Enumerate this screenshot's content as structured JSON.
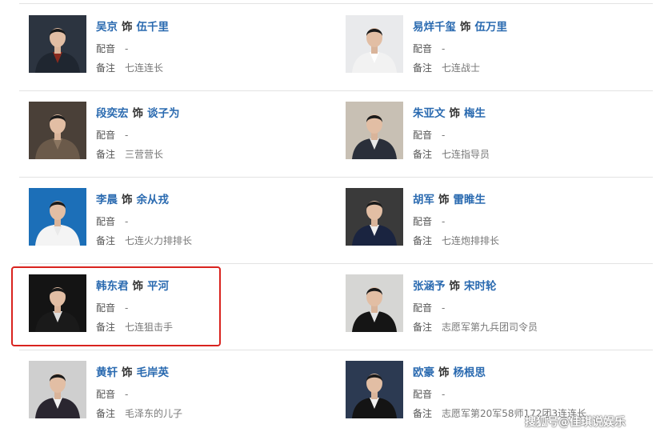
{
  "cast": {
    "role_word": "饰",
    "dub_label": "配音",
    "note_label": "备注",
    "rows": [
      {
        "left": {
          "actor": "吴京",
          "character": "伍千里",
          "dub": "-",
          "note": "七连连长",
          "bg": "#2c3440",
          "suit": "#1f2630",
          "shirt": "#8a2a1e"
        },
        "right": {
          "actor": "易烊千玺",
          "character": "伍万里",
          "dub": "-",
          "note": "七连战士",
          "bg": "#e9eaec",
          "suit": "#f2f2f2",
          "shirt": "#ffffff"
        }
      },
      {
        "left": {
          "actor": "段奕宏",
          "character": "谈子为",
          "dub": "-",
          "note": "三营营长",
          "bg": "#4a4038",
          "suit": "#6b5a4a",
          "shirt": "#8a7560"
        },
        "right": {
          "actor": "朱亚文",
          "character": "梅生",
          "dub": "-",
          "note": "七连指导员",
          "bg": "#c8c0b4",
          "suit": "#2a2f3a",
          "shirt": "#e8e8e8"
        }
      },
      {
        "left": {
          "actor": "李晨",
          "character": "余从戎",
          "dub": "-",
          "note": "七连火力排排长",
          "bg": "#1c6fb8",
          "suit": "#f4f4f4",
          "shirt": "#eaeaea"
        },
        "right": {
          "actor": "胡军",
          "character": "雷睢生",
          "dub": "-",
          "note": "七连炮排排长",
          "bg": "#3a3a3a",
          "suit": "#1a2440",
          "shirt": "#f0f0f0"
        }
      },
      {
        "left": {
          "actor": "韩东君",
          "character": "平河",
          "dub": "-",
          "note": "七连狙击手",
          "bg": "#141414",
          "suit": "#1a1a1a",
          "shirt": "#dcdcdc"
        },
        "right": {
          "actor": "张涵予",
          "character": "宋时轮",
          "dub": "-",
          "note": "志愿军第九兵团司令员",
          "bg": "#d6d6d4",
          "suit": "#151515",
          "shirt": "#e6e6e6"
        }
      },
      {
        "left": {
          "actor": "黄轩",
          "character": "毛岸英",
          "dub": "-",
          "note": "毛泽东的儿子",
          "bg": "#cfcfcf",
          "suit": "#2a2630",
          "shirt": "#f2f2f2"
        },
        "right": {
          "actor": "欧豪",
          "character": "杨根思",
          "dub": "-",
          "note": "志愿军第20军58师172团3连连长",
          "bg": "#2c3a52",
          "suit": "#141414",
          "shirt": "#f0f0f0"
        }
      }
    ]
  },
  "watermark": "搜狐号@佳琪说娱乐",
  "colors": {
    "link": "#2a6ab0",
    "highlight": "#d9231f"
  }
}
